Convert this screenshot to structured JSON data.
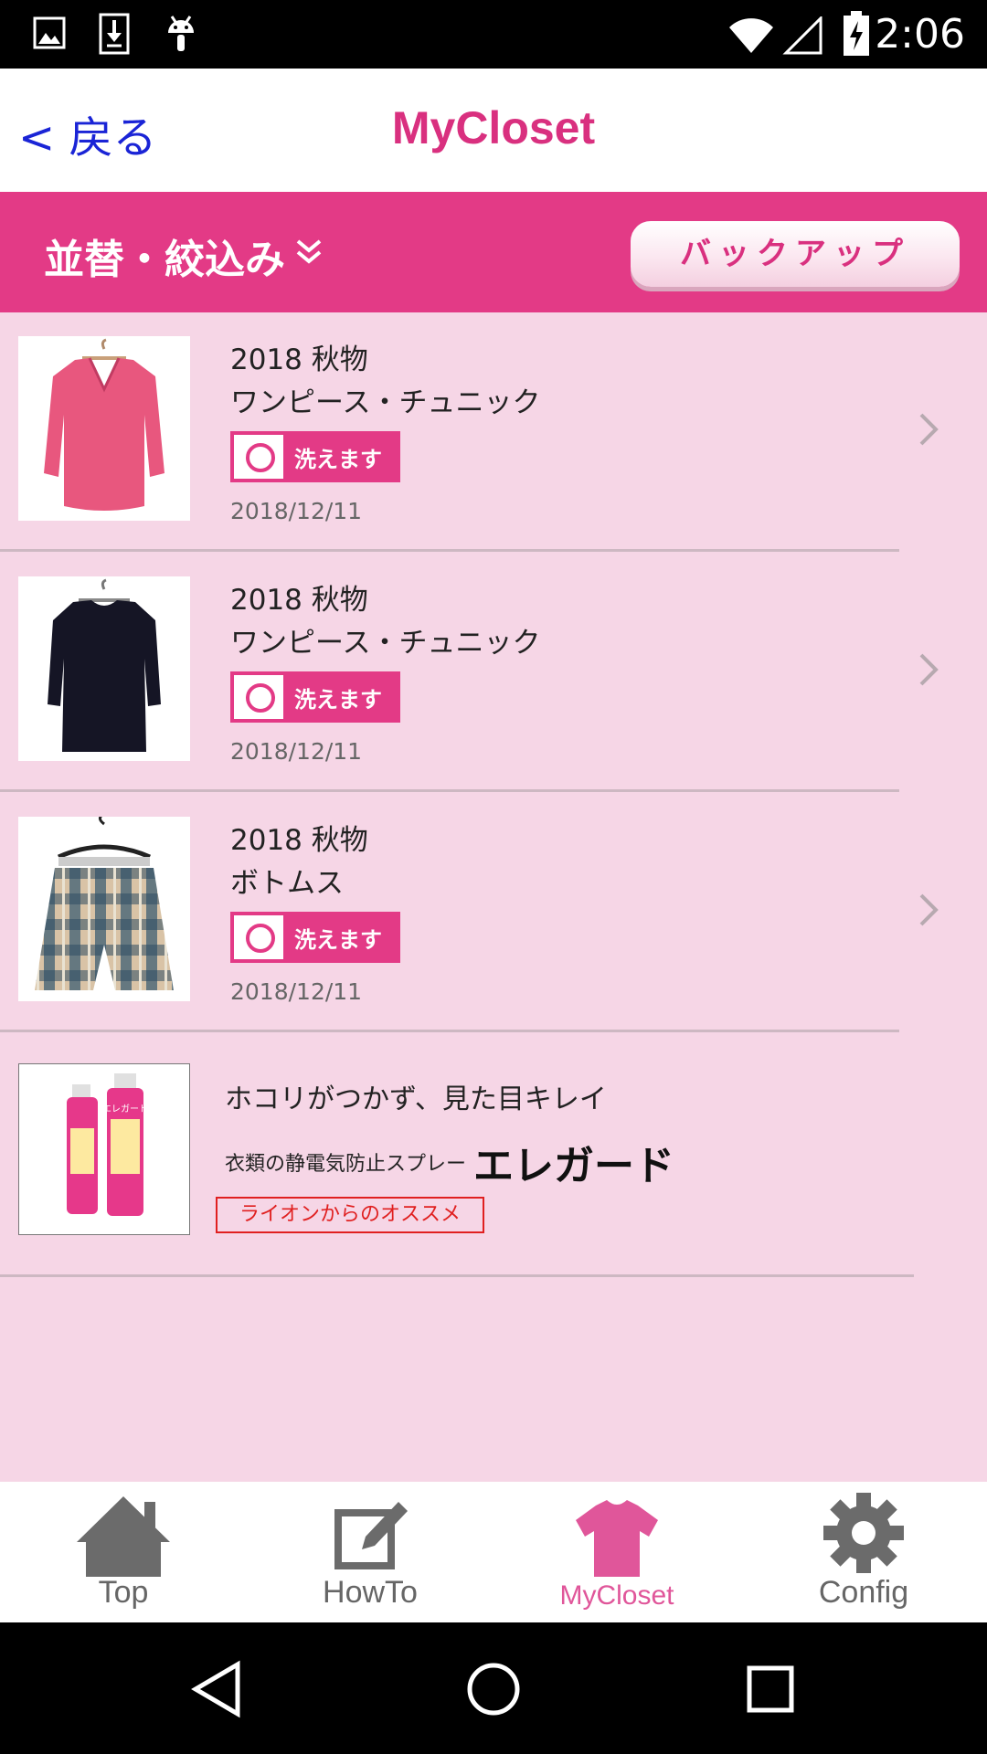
{
  "status_bar": {
    "time": "2:06",
    "icons": [
      "image-icon",
      "download-icon",
      "android-icon",
      "wifi-icon",
      "signal-icon",
      "battery-charging-icon"
    ]
  },
  "header": {
    "back_label": "< 戻る",
    "title": "MyCloset"
  },
  "toolbar": {
    "filter_label": "並替・絞込み",
    "backup_label": "バックアップ"
  },
  "items": [
    {
      "season": "2018 秋物",
      "category": "ワンピース・チュニック",
      "wash_label": "洗えます",
      "date": "2018/12/11",
      "image": "pink-sweater"
    },
    {
      "season": "2018 秋物",
      "category": "ワンピース・チュニック",
      "wash_label": "洗えます",
      "date": "2018/12/11",
      "image": "black-dress"
    },
    {
      "season": "2018 秋物",
      "category": "ボトムス",
      "wash_label": "洗えます",
      "date": "2018/12/11",
      "image": "plaid-shorts"
    }
  ],
  "ad": {
    "tagline": "ホコリがつかず、見た目キレイ",
    "description": "衣類の静電気防止スプレー",
    "brand": "エレガード",
    "recommendation": "ライオンからのオススメ",
    "product_label": "エレガード"
  },
  "tabs": [
    {
      "label": "Top",
      "icon": "home-icon",
      "active": false
    },
    {
      "label": "HowTo",
      "icon": "edit-icon",
      "active": false
    },
    {
      "label": "MyCloset",
      "icon": "tshirt-icon",
      "active": true
    },
    {
      "label": "Config",
      "icon": "gear-icon",
      "active": false
    }
  ],
  "colors": {
    "accent_pink": "#e33a86",
    "title_pink": "#d9307f",
    "list_background": "#f6d6e6",
    "back_link": "#1a24d6",
    "recommend_red": "#e02020"
  }
}
